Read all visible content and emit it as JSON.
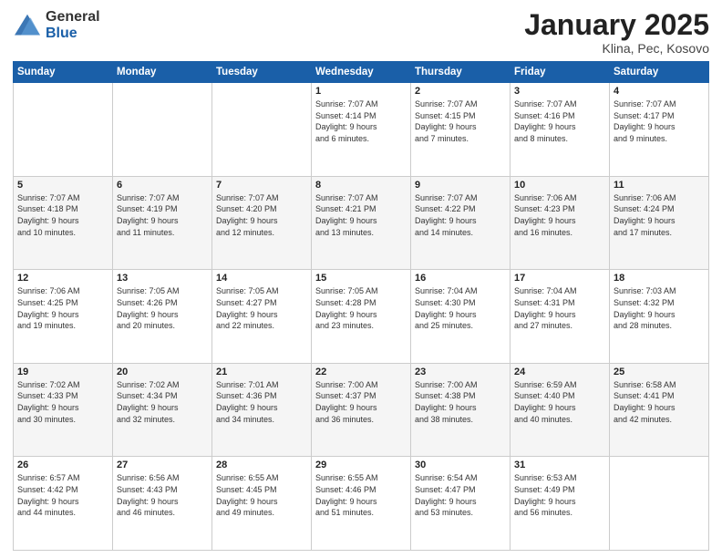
{
  "header": {
    "logo_general": "General",
    "logo_blue": "Blue",
    "title": "January 2025",
    "subtitle": "Klina, Pec, Kosovo"
  },
  "calendar": {
    "days_of_week": [
      "Sunday",
      "Monday",
      "Tuesday",
      "Wednesday",
      "Thursday",
      "Friday",
      "Saturday"
    ],
    "weeks": [
      [
        {
          "day": "",
          "info": ""
        },
        {
          "day": "",
          "info": ""
        },
        {
          "day": "",
          "info": ""
        },
        {
          "day": "1",
          "info": "Sunrise: 7:07 AM\nSunset: 4:14 PM\nDaylight: 9 hours\nand 6 minutes."
        },
        {
          "day": "2",
          "info": "Sunrise: 7:07 AM\nSunset: 4:15 PM\nDaylight: 9 hours\nand 7 minutes."
        },
        {
          "day": "3",
          "info": "Sunrise: 7:07 AM\nSunset: 4:16 PM\nDaylight: 9 hours\nand 8 minutes."
        },
        {
          "day": "4",
          "info": "Sunrise: 7:07 AM\nSunset: 4:17 PM\nDaylight: 9 hours\nand 9 minutes."
        }
      ],
      [
        {
          "day": "5",
          "info": "Sunrise: 7:07 AM\nSunset: 4:18 PM\nDaylight: 9 hours\nand 10 minutes."
        },
        {
          "day": "6",
          "info": "Sunrise: 7:07 AM\nSunset: 4:19 PM\nDaylight: 9 hours\nand 11 minutes."
        },
        {
          "day": "7",
          "info": "Sunrise: 7:07 AM\nSunset: 4:20 PM\nDaylight: 9 hours\nand 12 minutes."
        },
        {
          "day": "8",
          "info": "Sunrise: 7:07 AM\nSunset: 4:21 PM\nDaylight: 9 hours\nand 13 minutes."
        },
        {
          "day": "9",
          "info": "Sunrise: 7:07 AM\nSunset: 4:22 PM\nDaylight: 9 hours\nand 14 minutes."
        },
        {
          "day": "10",
          "info": "Sunrise: 7:06 AM\nSunset: 4:23 PM\nDaylight: 9 hours\nand 16 minutes."
        },
        {
          "day": "11",
          "info": "Sunrise: 7:06 AM\nSunset: 4:24 PM\nDaylight: 9 hours\nand 17 minutes."
        }
      ],
      [
        {
          "day": "12",
          "info": "Sunrise: 7:06 AM\nSunset: 4:25 PM\nDaylight: 9 hours\nand 19 minutes."
        },
        {
          "day": "13",
          "info": "Sunrise: 7:05 AM\nSunset: 4:26 PM\nDaylight: 9 hours\nand 20 minutes."
        },
        {
          "day": "14",
          "info": "Sunrise: 7:05 AM\nSunset: 4:27 PM\nDaylight: 9 hours\nand 22 minutes."
        },
        {
          "day": "15",
          "info": "Sunrise: 7:05 AM\nSunset: 4:28 PM\nDaylight: 9 hours\nand 23 minutes."
        },
        {
          "day": "16",
          "info": "Sunrise: 7:04 AM\nSunset: 4:30 PM\nDaylight: 9 hours\nand 25 minutes."
        },
        {
          "day": "17",
          "info": "Sunrise: 7:04 AM\nSunset: 4:31 PM\nDaylight: 9 hours\nand 27 minutes."
        },
        {
          "day": "18",
          "info": "Sunrise: 7:03 AM\nSunset: 4:32 PM\nDaylight: 9 hours\nand 28 minutes."
        }
      ],
      [
        {
          "day": "19",
          "info": "Sunrise: 7:02 AM\nSunset: 4:33 PM\nDaylight: 9 hours\nand 30 minutes."
        },
        {
          "day": "20",
          "info": "Sunrise: 7:02 AM\nSunset: 4:34 PM\nDaylight: 9 hours\nand 32 minutes."
        },
        {
          "day": "21",
          "info": "Sunrise: 7:01 AM\nSunset: 4:36 PM\nDaylight: 9 hours\nand 34 minutes."
        },
        {
          "day": "22",
          "info": "Sunrise: 7:00 AM\nSunset: 4:37 PM\nDaylight: 9 hours\nand 36 minutes."
        },
        {
          "day": "23",
          "info": "Sunrise: 7:00 AM\nSunset: 4:38 PM\nDaylight: 9 hours\nand 38 minutes."
        },
        {
          "day": "24",
          "info": "Sunrise: 6:59 AM\nSunset: 4:40 PM\nDaylight: 9 hours\nand 40 minutes."
        },
        {
          "day": "25",
          "info": "Sunrise: 6:58 AM\nSunset: 4:41 PM\nDaylight: 9 hours\nand 42 minutes."
        }
      ],
      [
        {
          "day": "26",
          "info": "Sunrise: 6:57 AM\nSunset: 4:42 PM\nDaylight: 9 hours\nand 44 minutes."
        },
        {
          "day": "27",
          "info": "Sunrise: 6:56 AM\nSunset: 4:43 PM\nDaylight: 9 hours\nand 46 minutes."
        },
        {
          "day": "28",
          "info": "Sunrise: 6:55 AM\nSunset: 4:45 PM\nDaylight: 9 hours\nand 49 minutes."
        },
        {
          "day": "29",
          "info": "Sunrise: 6:55 AM\nSunset: 4:46 PM\nDaylight: 9 hours\nand 51 minutes."
        },
        {
          "day": "30",
          "info": "Sunrise: 6:54 AM\nSunset: 4:47 PM\nDaylight: 9 hours\nand 53 minutes."
        },
        {
          "day": "31",
          "info": "Sunrise: 6:53 AM\nSunset: 4:49 PM\nDaylight: 9 hours\nand 56 minutes."
        },
        {
          "day": "",
          "info": ""
        }
      ]
    ]
  }
}
